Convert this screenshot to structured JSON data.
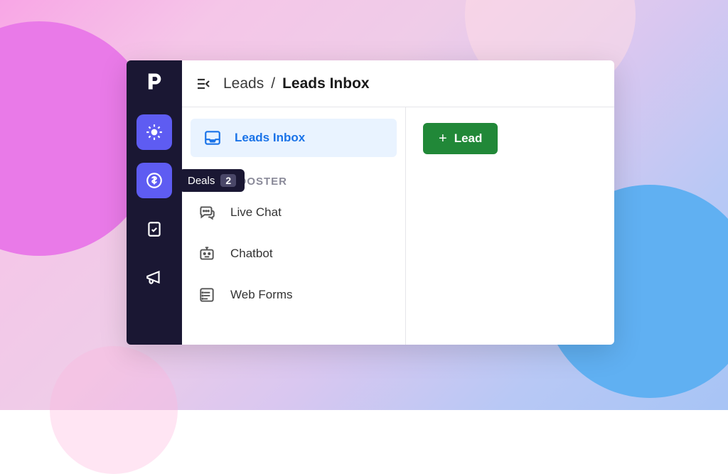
{
  "header": {
    "breadcrumb_parent": "Leads",
    "breadcrumb_current": "Leads Inbox"
  },
  "sidebar": {
    "tooltip_label": "Deals",
    "tooltip_badge": "2"
  },
  "secondary_nav": {
    "selected_label": "Leads Inbox",
    "section_header": "LEADBOOSTER",
    "items": [
      {
        "label": "Live Chat"
      },
      {
        "label": "Chatbot"
      },
      {
        "label": "Web Forms"
      }
    ]
  },
  "actions": {
    "add_lead": "Lead"
  }
}
